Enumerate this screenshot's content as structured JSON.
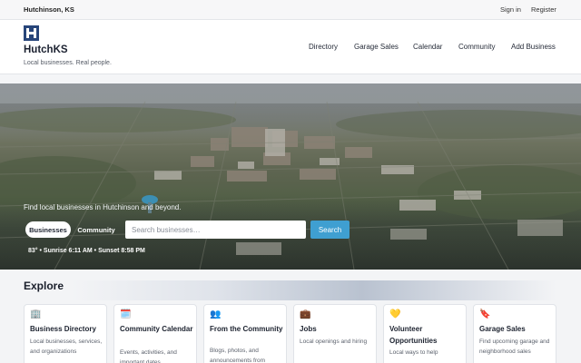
{
  "topbar": {
    "location": "Hutchinson, KS",
    "sign_in": "Sign in",
    "register": "Register"
  },
  "header": {
    "site_name": "HutchKS",
    "tagline": "Local businesses. Real people.",
    "logo_icon": "hutchks-logo-icon",
    "brand_color": "#27457a",
    "nav": [
      "Directory",
      "Garage Sales",
      "Calendar",
      "Community",
      "Add Business"
    ]
  },
  "hero": {
    "headline": "Find local businesses in Hutchinson and beyond.",
    "tabs": [
      "Businesses",
      "Community"
    ],
    "active_tab": "Businesses",
    "search_placeholder": "Search businesses…",
    "search_button": "Search",
    "accent_color": "#3f9fd1",
    "weather": "83° • Sunrise 6:11 AM • Sunset 8:58 PM"
  },
  "explore": {
    "title": "Explore",
    "cards": [
      {
        "icon": "building-icon",
        "glyph": "🏢",
        "title": "Business Directory",
        "desc": "Local businesses, services, and organizations"
      },
      {
        "icon": "calendar-icon",
        "glyph": "🗓️",
        "title": "Community Calendar",
        "desc": "Events, activities, and important dates"
      },
      {
        "icon": "people-icon",
        "glyph": "👥",
        "title": "From the Community",
        "desc": "Blogs, photos, and announcements from"
      },
      {
        "icon": "briefcase-icon",
        "glyph": "💼",
        "title": "Jobs",
        "desc": "Local openings and hiring"
      },
      {
        "icon": "heart-icon",
        "glyph": "💛",
        "title": "Volunteer Opportunities",
        "desc": "Local ways to help"
      },
      {
        "icon": "tag-icon",
        "glyph": "🔖",
        "title": "Garage Sales",
        "desc": "Find upcoming garage and neighborhood sales"
      }
    ]
  }
}
